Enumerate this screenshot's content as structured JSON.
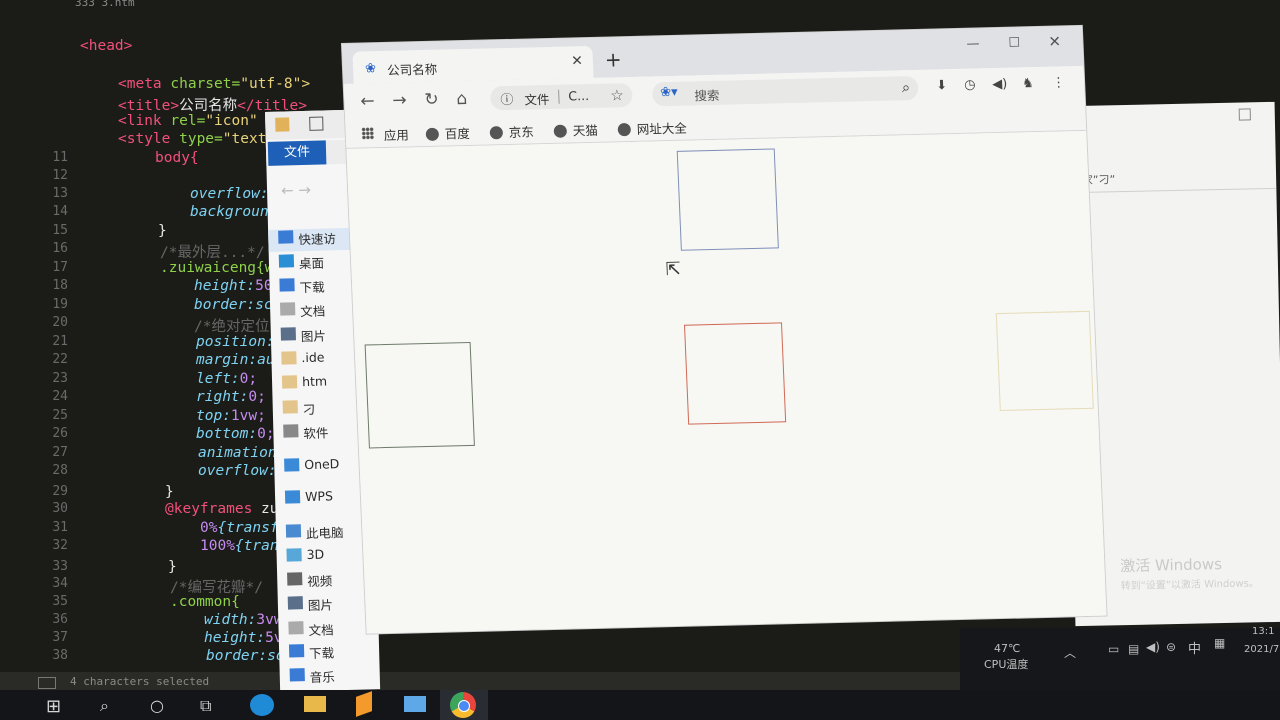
{
  "editor": {
    "file_tab": "333 3.htm",
    "line_numbers": [
      "11",
      "12",
      "13",
      "14",
      "15",
      "16",
      "17",
      "18",
      "19",
      "20",
      "21",
      "22",
      "23",
      "24",
      "25",
      "26",
      "27",
      "28",
      "29",
      "30",
      "31",
      "32",
      "33",
      "34",
      "35",
      "36",
      "37",
      "38"
    ],
    "lines": {
      "head": "<head>",
      "meta_tag": "<meta",
      "meta_attr": " charset=",
      "meta_val": "\"utf-8\">",
      "title_open": "<title>",
      "title_text": "公司名称",
      "title_close": "</title>",
      "link_tag": "<link",
      "link_attr": " rel=",
      "link_val": "\"icon\"",
      "style_tag": "<style",
      "style_attr": " type=",
      "style_val": "\"text",
      "body_sel": "body{",
      "l13": "overflow:",
      "l14": "backgroun",
      "l15": "}",
      "l16": "/*最外层...*/",
      "l17": ".zuiwaiceng{w",
      "l18a": "height:",
      "l18b": "50",
      "l19": "border:sc",
      "l20": "/*绝对定位*/",
      "l21": "position:",
      "l22": "margin:au",
      "l23a": "left:",
      "l23b": "0;",
      "l24a": "right:",
      "l24b": "0;",
      "l25a": "top:",
      "l25b": "1vw;",
      "l26a": "bottom:",
      "l26b": "0;",
      "l27": "animation",
      "l28": "overflow:",
      "l29": "}",
      "l30a": "@keyframes",
      "l30b": " zu",
      "l31a": "0%",
      "l31b": "{transf",
      "l32a": "100%",
      "l32b": "{tran",
      "l33": "}",
      "l34": "/*编写花瓣*/",
      "l35": ".common{",
      "l36a": "width:",
      "l36b": "3vw",
      "l37a": "height:",
      "l37b": "5v",
      "l38": "border:so"
    },
    "status_text": "4 characters selected"
  },
  "explorer": {
    "file_menu": "文件",
    "items": [
      {
        "label": "快速访",
        "icon": "star-icon"
      },
      {
        "label": "桌面",
        "icon": "desktop-icon"
      },
      {
        "label": "下载",
        "icon": "download-icon"
      },
      {
        "label": "文档",
        "icon": "document-icon"
      },
      {
        "label": "图片",
        "icon": "picture-icon"
      },
      {
        "label": ".ide",
        "icon": "folder-icon"
      },
      {
        "label": "htm",
        "icon": "folder-icon"
      },
      {
        "label": "刁",
        "icon": "folder-icon"
      },
      {
        "label": "软件",
        "icon": "drive-icon"
      },
      {
        "label": "OneD",
        "icon": "cloud-icon"
      },
      {
        "label": "WPS",
        "icon": "cloud-icon"
      },
      {
        "label": "此电脑",
        "icon": "computer-icon"
      },
      {
        "label": "3D",
        "icon": "cube-icon"
      },
      {
        "label": "视频",
        "icon": "video-icon"
      },
      {
        "label": "图片",
        "icon": "picture-icon"
      },
      {
        "label": "文档",
        "icon": "document-icon"
      },
      {
        "label": "下载",
        "icon": "download-icon"
      },
      {
        "label": "音乐",
        "icon": "music-icon"
      }
    ]
  },
  "bg_window": {
    "bar_text": "“家”刁”",
    "activate_title": "激活 Windows",
    "activate_sub": "转到“设置”以激活 Windows。"
  },
  "browser": {
    "tab_title": "公司名称",
    "omnibox_info": "文件",
    "omnibox_url": "C...",
    "search_placeholder": "搜索",
    "bookmarks": [
      "应用",
      "百度",
      "京东",
      "天猫",
      "网址大全"
    ],
    "squares_colors": {
      "top": "#7f8fb8",
      "left": "#6e7a6a",
      "center": "#d06a55",
      "right": "#e6dcb8"
    }
  },
  "taskbar": {
    "temp": "47℃",
    "temp_label": "CPU温度",
    "ime": "中",
    "time": "13:1",
    "date": "2021/7"
  }
}
